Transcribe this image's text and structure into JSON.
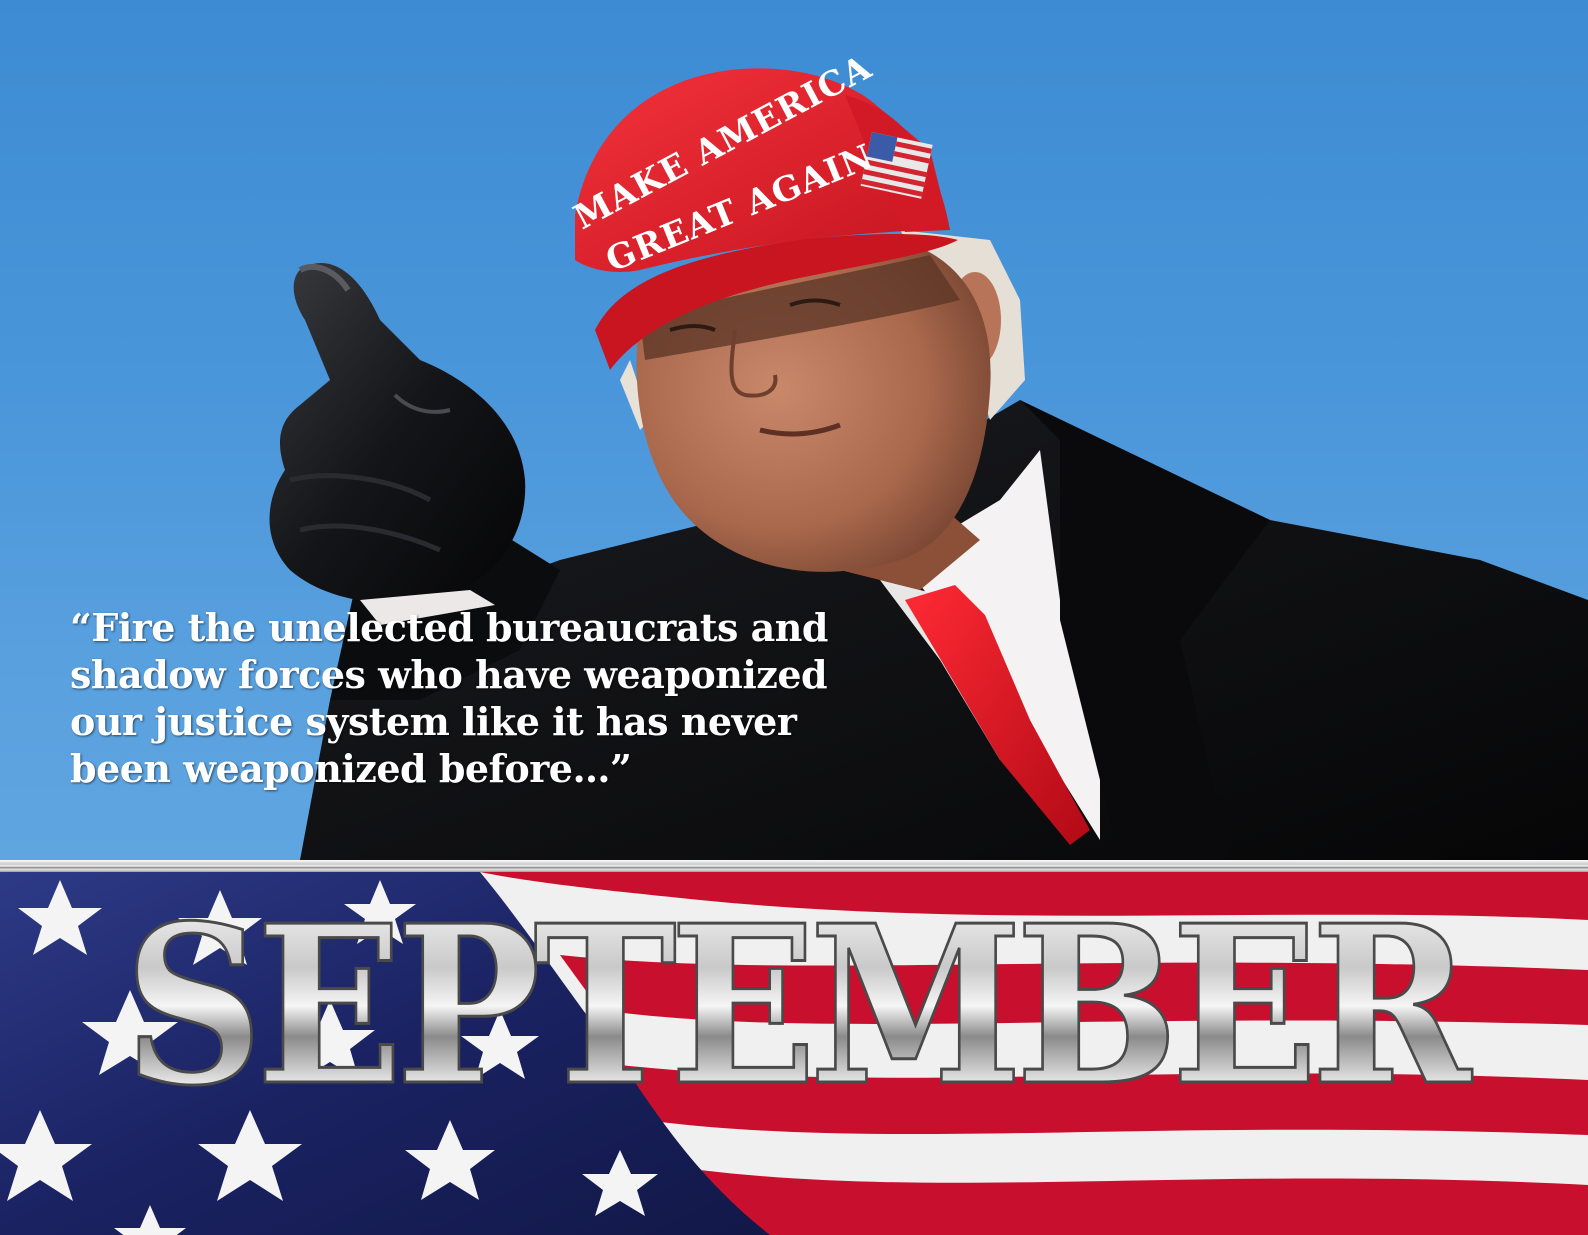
{
  "hat": {
    "line1": "MAKE AMERICA",
    "line2": "GREAT AGAIN"
  },
  "quote": {
    "lines": [
      "“Fire the unelected bureaucrats and",
      "shadow forces who have weaponized",
      "our justice system like it has never",
      "been weaponized before…”"
    ]
  },
  "banner": {
    "month": "SEPTEMBER"
  },
  "colors": {
    "sky": "#4a96da",
    "cap_red": "#e3212b",
    "coat": "#0e0f12",
    "flag_red": "#c8102e",
    "flag_blue": "#1f2a6e",
    "chrome": "#d9d9d9"
  }
}
